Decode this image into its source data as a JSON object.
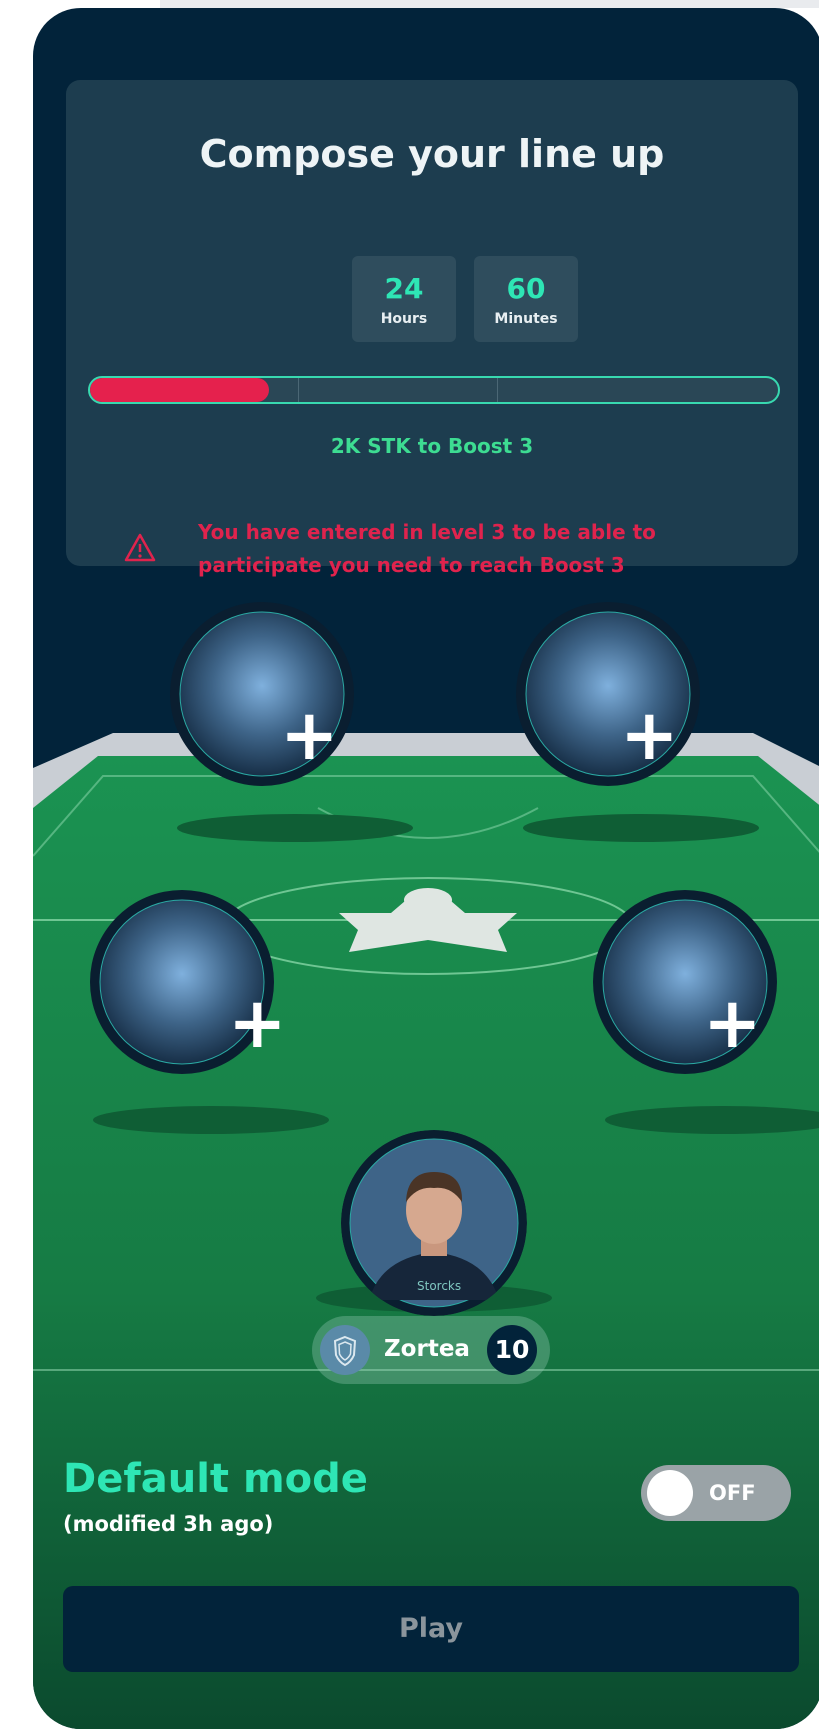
{
  "header": {
    "title": "Compose your line up",
    "timer": [
      {
        "value": "24",
        "unit": "Hours"
      },
      {
        "value": "60",
        "unit": "Minutes"
      }
    ]
  },
  "progress": {
    "fraction": 0.26,
    "label": "2K STK to Boost 3"
  },
  "warning": {
    "text": "You have entered in level 3 to be able to participate you need to reach Boost 3",
    "icon": "warning-triangle-icon"
  },
  "lineup": {
    "empty_slot_icon": "plus-icon",
    "player": {
      "name": "Zortea",
      "number": "10",
      "club_icon": "shield-icon"
    }
  },
  "mode": {
    "title": "Default mode",
    "subtitle": "(modified 3h ago)",
    "toggle_label": "OFF"
  },
  "actions": {
    "play_label": "Play"
  },
  "colors": {
    "background": "#02233a",
    "accent": "#2ee6b5",
    "danger": "#e5214d",
    "pitch": "#1a8a4a"
  }
}
